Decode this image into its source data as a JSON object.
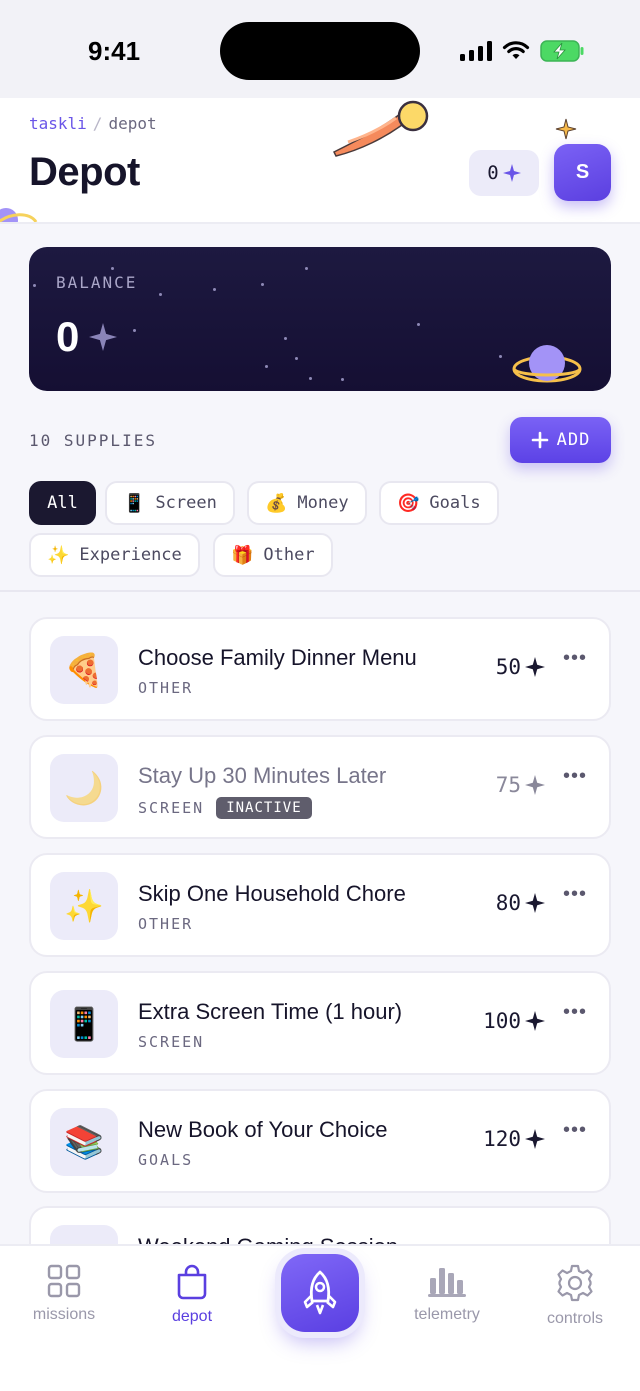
{
  "status_bar": {
    "time": "9:41"
  },
  "breadcrumb": {
    "root": "taskli",
    "separator": "/",
    "current": "depot"
  },
  "header": {
    "title": "Depot",
    "points": "0",
    "avatar_initial": "S"
  },
  "balance": {
    "label": "BALANCE",
    "value": "0"
  },
  "supplies": {
    "count_label": "10 SUPPLIES",
    "add_label": "ADD"
  },
  "filters": [
    {
      "label": "All",
      "emoji": ""
    },
    {
      "label": "Screen",
      "emoji": "📱"
    },
    {
      "label": "Money",
      "emoji": "💰"
    },
    {
      "label": "Goals",
      "emoji": "🎯"
    },
    {
      "label": "Experience",
      "emoji": "✨"
    },
    {
      "label": "Other",
      "emoji": "🎁"
    }
  ],
  "items": [
    {
      "title": "Choose Family Dinner Menu",
      "category": "OTHER",
      "points": "50",
      "emoji": "🍕",
      "badge": ""
    },
    {
      "title": "Stay Up 30 Minutes Later",
      "category": "SCREEN",
      "points": "75",
      "emoji": "🌙",
      "badge": "INACTIVE"
    },
    {
      "title": "Skip One Household Chore",
      "category": "OTHER",
      "points": "80",
      "emoji": "✨",
      "badge": ""
    },
    {
      "title": "Extra Screen Time (1 hour)",
      "category": "SCREEN",
      "points": "100",
      "emoji": "📱",
      "badge": ""
    },
    {
      "title": "New Book of Your Choice",
      "category": "GOALS",
      "points": "120",
      "emoji": "📚",
      "badge": ""
    },
    {
      "title": "Weekend Gaming Session",
      "category": "",
      "points": "",
      "emoji": "",
      "badge": ""
    }
  ],
  "item_more": "•••",
  "nav": {
    "missions": "missions",
    "depot": "depot",
    "telemetry": "telemetry",
    "controls": "controls"
  },
  "colors": {
    "accent": "#5a3fe0",
    "balance_bg": "#1a1640",
    "inactive_badge": "#5f5d6c"
  }
}
